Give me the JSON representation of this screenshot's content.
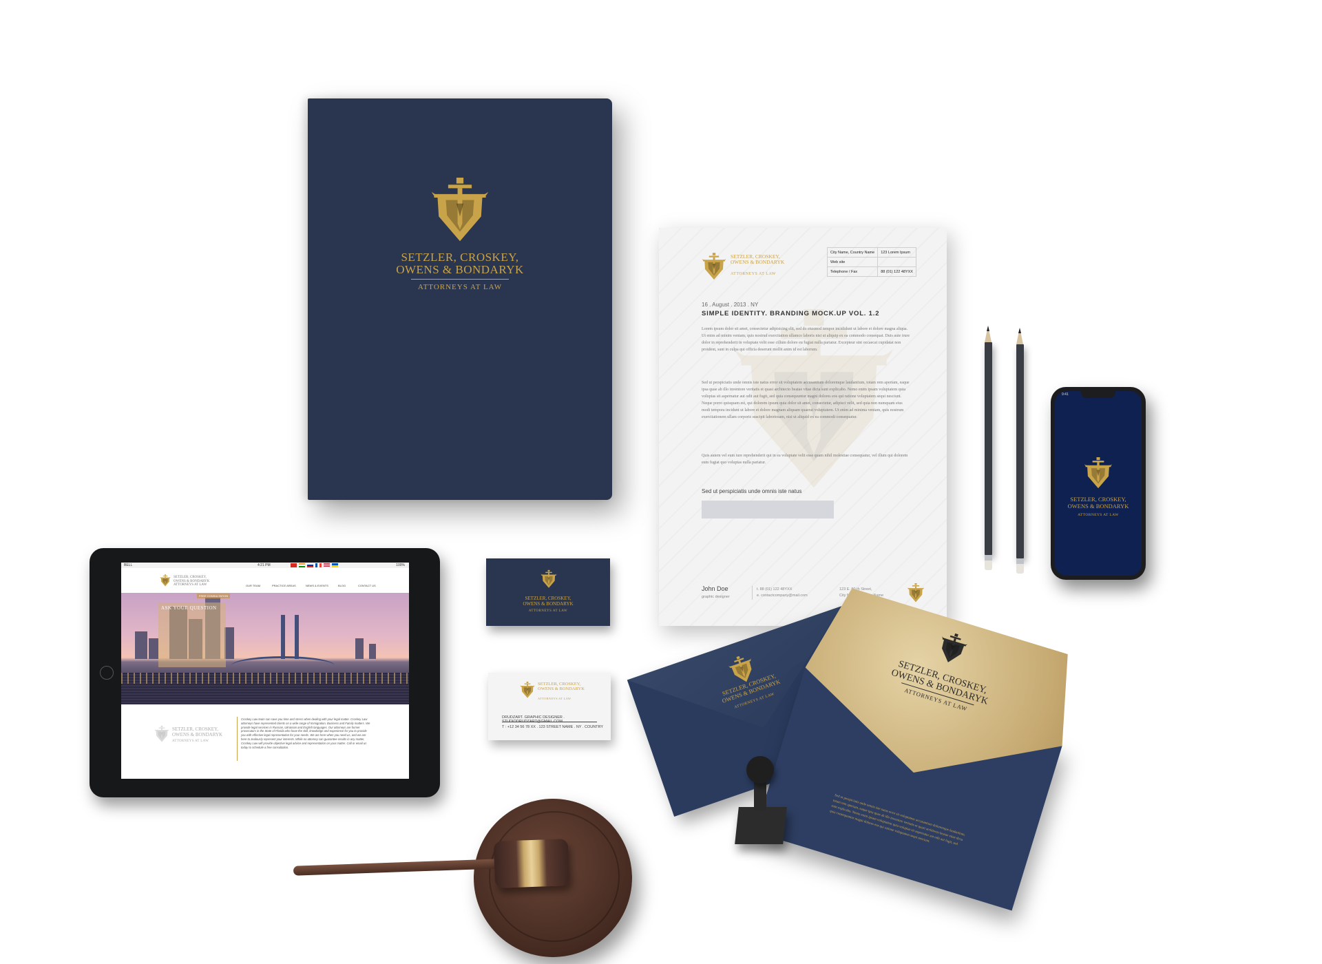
{
  "brand": {
    "name_line1": "SETZLER, CROSKEY,",
    "name_line2": "OWENS & BONDARYK",
    "subtitle": "ATTORNEYS AT LAW",
    "colors": {
      "navy": "#2a3650",
      "gold": "#c9a349",
      "phone_screen": "#0f2150"
    }
  },
  "letterhead": {
    "contact_rows": [
      [
        "City Name, Country Name",
        "123 Lorem Ipsum"
      ],
      [
        "Web site",
        ""
      ],
      [
        "Telephone / Fax",
        "88 (01) 122 48YXX"
      ]
    ],
    "date": "16 . August . 2013 . NY",
    "title": "SIMPLE IDENTITY. BRANDING MOCK.UP VOL. 1.2",
    "paragraph1": "Lorem ipsum dolor sit amet, consectetur adipisicing elit, sed do eiusmod tempor incididunt ut labore et dolore magna aliqua. Ut enim ad minim veniam, quis nostrud exercitation ullamco laboris nisi ut aliquip ex ea commodo consequat. Duis aute irure dolor in reprehenderit in voluptate velit esse cillum dolore eu fugiat nulla pariatur. Excepteur sint occaecat cupidatat non proident, sunt in culpa qui officia deserunt mollit anim id est laborum.",
    "paragraph2": "Sed ut perspiciatis unde omnis iste natus error sit voluptatem accusantium doloremque laudantium, totam rem aperiam, eaque ipsa quae ab illo inventore veritatis et quasi architecto beatae vitae dicta sunt explicabo. Nemo enim ipsam voluptatem quia voluptas sit aspernatur aut odit aut fugit, sed quia consequuntur magni dolores eos qui ratione voluptatem sequi nesciunt. Neque porro quisquam est, qui dolorem ipsum quia dolor sit amet, consectetur, adipisci velit, sed quia non numquam eius modi tempora incidunt ut labore et dolore magnam aliquam quaerat voluptatem. Ut enim ad minima veniam, quis nostrum exercitationem ullam corporis suscipit laboriosam, nisi ut aliquid ex ea commodi consequatur.",
    "paragraph3": "Quis autem vel eum iure reprehenderit qui in ea voluptate velit esse quam nihil molestiae consequatur, vel illum qui dolorem eum fugiat quo voluptas nulla pariatur.",
    "subheading": "Sed ut perspiciatis unde omnis iste natus",
    "signature_name": "John Doe",
    "signature_role": "graphic designer",
    "footer_phone": "t. 88 (01) 122 48YXX",
    "footer_email": "e. contactcompany@mail.com",
    "footer_addr1": "123 E. 90 th Street,",
    "footer_addr2": "City Name, Country Name"
  },
  "phone": {
    "status_time": "9:41"
  },
  "business_card_back": {
    "line1": "DRUDZART. GRAPHIC DESIGNER . STUDIODRUDZART@GMAIL.COM",
    "line2": "T : +12 34 56 78 XX . 123 STREET NAME . NY . COUNTRY"
  },
  "tablet": {
    "carrier": "BELL",
    "time": "4:21 PM",
    "battery": "100%",
    "nav": [
      "OUR TEAM",
      "PRACTICE AREAS",
      "NEWS & EVENTS",
      "BLOG",
      "CONTACT US"
    ],
    "hero_label": "FREE CONSULTATION",
    "form_title": "ASK YOUR QUESTION",
    "body_text": "Croskey Law team can save you time and stress when dealing with your legal matter. Croskey Law attorneys have represented clients on a wide range of Immigration, Business and Family matters. We provide legal services in Russian, Ukrainian and English languages. Our attorneys are former prosecutors in the State of Florida who have the skill, knowledge and experience for you to provide you with effective legal representation for your needs. We are here when you need us, and we are here to zealously represent your interests. While no attorney can guarantee results in any matter, Croskey Law will provide objective legal advice and representation on your matter. Call or email us today to schedule a free consultation."
  },
  "envelope_text": "Sed ut perspiciatis unde omnis iste natus error sit voluptatem accusantium doloremque laudantium, totam rem aperiam, eaque ipsa quae ab illo inventore veritatis et quasi architecto beatae vitae dicta sunt explicabo. Nemo enim ipsam voluptatem quia voluptas sit aspernatur aut odit aut fugit, sed quia consequuntur magni dolores eos qui ratione voluptatem sequi nesciunt."
}
